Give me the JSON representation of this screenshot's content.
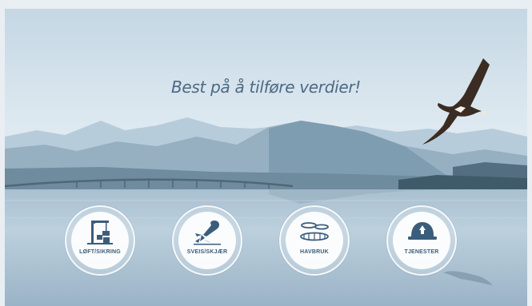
{
  "hero": {
    "tagline": "Best på å tilføre verdier!"
  },
  "services": [
    {
      "label": "LØFT/SIKRING",
      "icon": "crane-icon"
    },
    {
      "label": "SVEIS/SKJÆR",
      "icon": "welding-icon"
    },
    {
      "label": "HAVBRUK",
      "icon": "fish-farm-icon"
    },
    {
      "label": "TJENESTER",
      "icon": "helmet-icon"
    }
  ],
  "colors": {
    "text": "#4c6a85",
    "icon": "#3b5d7c",
    "sky": "#d5e3ec",
    "water": "#9db6c8"
  }
}
